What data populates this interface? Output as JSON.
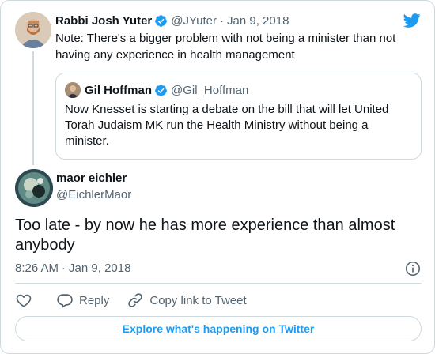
{
  "colors": {
    "accent": "#1d9bf0",
    "text_primary": "#0f1419",
    "text_secondary": "#536471",
    "border": "#cfd9de"
  },
  "header": {
    "logo_icon": "twitter-bird-icon"
  },
  "parent_tweet": {
    "author_name": "Rabbi Josh Yuter",
    "verified_icon": "verified-badge-icon",
    "handle": "@JYuter",
    "separator": "·",
    "date": "Jan 9, 2018",
    "text": "Note: There's a bigger problem with not being a minister than not having any experience in health management",
    "quoted_tweet": {
      "author_name": "Gil Hoffman",
      "verified_icon": "verified-badge-icon",
      "handle": "@Gil_Hoffman",
      "text": "Now Knesset is starting a debate on the bill that will let United Torah Judaism MK run the Health Ministry without being a minister."
    }
  },
  "main_tweet": {
    "author_name": "maor eichler",
    "handle": "@EichlerMaor",
    "text": "Too late - by now he has more experience than almost anybody",
    "time": "8:26 AM",
    "separator": "·",
    "date": "Jan 9, 2018",
    "info_icon": "info-icon"
  },
  "actions": {
    "like_icon": "heart-icon",
    "reply_icon": "reply-bubble-icon",
    "reply_label": "Reply",
    "copy_link_icon": "link-icon",
    "copy_link_label": "Copy link to Tweet"
  },
  "explore_button": {
    "label": "Explore what's happening on Twitter"
  }
}
